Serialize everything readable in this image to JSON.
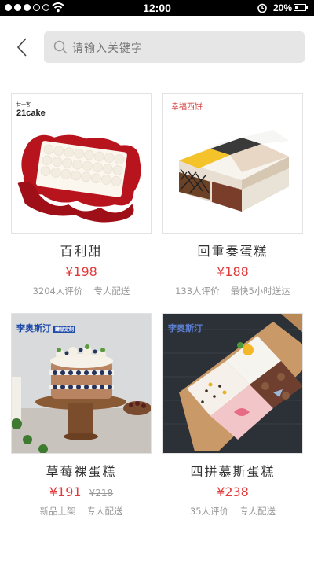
{
  "status_bar": {
    "time": "12:00",
    "battery_percent": "20%",
    "signal_bars": 3
  },
  "header": {
    "search_placeholder": "请输入关键字"
  },
  "products": [
    {
      "name": "百利甜",
      "price": "¥198",
      "old_price": "",
      "meta_left": "3204人评价",
      "meta_right": "专人配送",
      "brand_text": "21cake",
      "brand_sub": "廿一客"
    },
    {
      "name": "回重奏蛋糕",
      "price": "¥188",
      "old_price": "",
      "meta_left": "133人评价",
      "meta_right": "最快5小时送达",
      "brand_text": "幸福西饼",
      "brand_sub": ""
    },
    {
      "name": "草莓裸蛋糕",
      "price": "¥191",
      "old_price": "¥218",
      "meta_left": "新品上架",
      "meta_right": "专人配送",
      "brand_text": "李奥斯汀",
      "brand_sub": "臻品定制"
    },
    {
      "name": "四拼慕斯蛋糕",
      "price": "¥238",
      "old_price": "",
      "meta_left": "35人评价",
      "meta_right": "专人配送",
      "brand_text": "李奥斯汀",
      "brand_sub": ""
    }
  ],
  "colors": {
    "price": "#e23a3a",
    "status_bar_bg": "#000000",
    "search_bg": "#e6e6e6"
  }
}
